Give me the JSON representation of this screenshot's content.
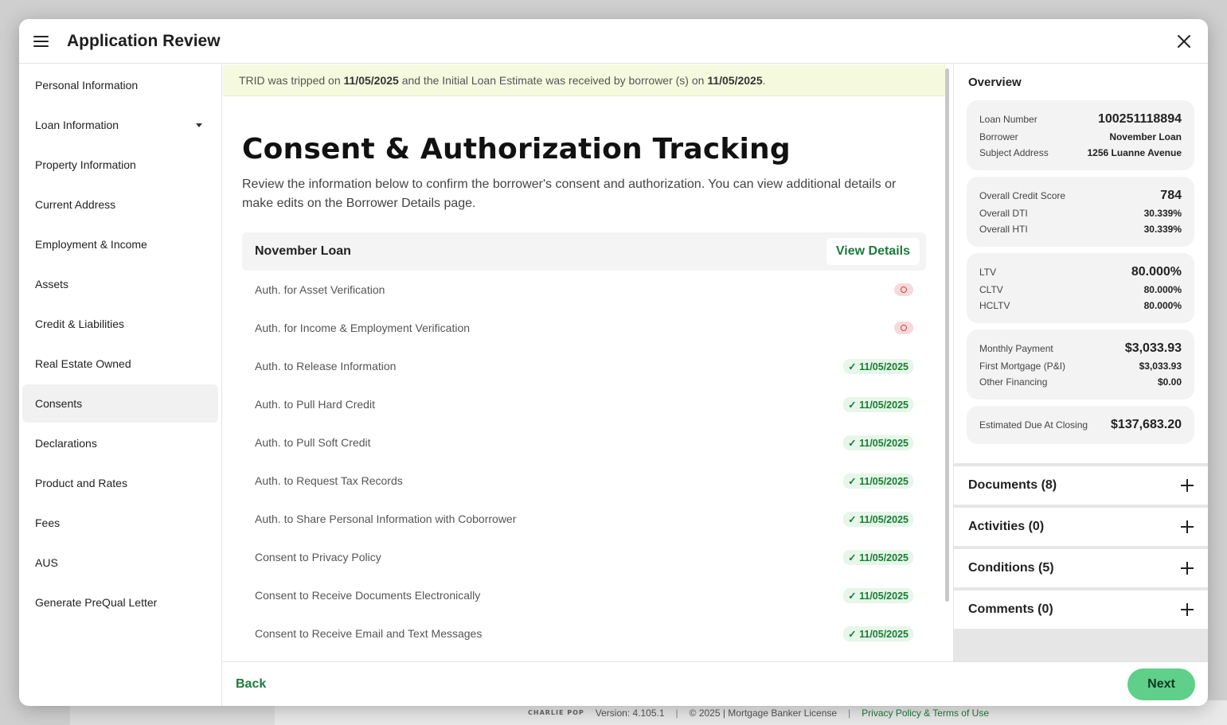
{
  "modal": {
    "title": "Application Review"
  },
  "sidebar": {
    "items": [
      {
        "label": "Personal Information"
      },
      {
        "label": "Loan Information"
      },
      {
        "label": "Property Information"
      },
      {
        "label": "Current Address"
      },
      {
        "label": "Employment & Income"
      },
      {
        "label": "Assets"
      },
      {
        "label": "Credit & Liabilities"
      },
      {
        "label": "Real Estate Owned"
      },
      {
        "label": "Consents"
      },
      {
        "label": "Declarations"
      },
      {
        "label": "Product and Rates"
      },
      {
        "label": "Fees"
      },
      {
        "label": "AUS"
      },
      {
        "label": "Generate PreQual Letter"
      }
    ]
  },
  "banner": {
    "prefix": "TRID was tripped on ",
    "date1": "11/05/2025",
    "middle": " and the Initial Loan Estimate was received by borrower (s) on ",
    "date2": "11/05/2025",
    "suffix": "."
  },
  "main": {
    "title": "Consent & Authorization Tracking",
    "description": "Review the information below to confirm the borrower's consent and authorization. You can view additional details or make edits on the Borrower Details page.",
    "borrower_name": "November Loan",
    "view_details_label": "View Details",
    "rows": [
      {
        "label": "Auth. for Asset Verification",
        "date": ""
      },
      {
        "label": "Auth. for Income & Employment Verification",
        "date": ""
      },
      {
        "label": "Auth. to Release Information",
        "date": "✓ 11/05/2025"
      },
      {
        "label": "Auth. to Pull Hard Credit",
        "date": "✓ 11/05/2025"
      },
      {
        "label": "Auth. to Pull Soft Credit",
        "date": "✓ 11/05/2025"
      },
      {
        "label": "Auth. to Request Tax Records",
        "date": "✓ 11/05/2025"
      },
      {
        "label": "Auth. to Share Personal Information with Coborrower",
        "date": "✓ 11/05/2025"
      },
      {
        "label": "Consent to Privacy Policy",
        "date": "✓ 11/05/2025"
      },
      {
        "label": "Consent to Receive Documents Electronically",
        "date": "✓ 11/05/2025"
      },
      {
        "label": "Consent to Receive Email and Text Messages",
        "date": "✓ 11/05/2025"
      }
    ]
  },
  "footer": {
    "back_label": "Back",
    "next_label": "Next"
  },
  "overview": {
    "title": "Overview",
    "cards": [
      [
        {
          "label": "Loan Number",
          "value": "100251118894",
          "big": true
        },
        {
          "label": "Borrower",
          "value": "November Loan"
        },
        {
          "label": "Subject Address",
          "value": "1256 Luanne Avenue"
        }
      ],
      [
        {
          "label": "Overall Credit Score",
          "value": "784",
          "big": true
        },
        {
          "label": "Overall DTI",
          "value": "30.339%"
        },
        {
          "label": "Overall HTI",
          "value": "30.339%"
        }
      ],
      [
        {
          "label": "LTV",
          "value": "80.000%",
          "big": true
        },
        {
          "label": "CLTV",
          "value": "80.000%"
        },
        {
          "label": "HCLTV",
          "value": "80.000%"
        }
      ],
      [
        {
          "label": "Monthly Payment",
          "value": "$3,033.93",
          "big": true
        },
        {
          "label": "First Mortgage (P&I)",
          "value": "$3,033.93"
        },
        {
          "label": "Other Financing",
          "value": "$0.00"
        }
      ],
      [
        {
          "label": "Estimated Due At Closing",
          "value": "$137,683.20",
          "big": true
        }
      ]
    ]
  },
  "accordions": [
    {
      "label": "Documents (8)"
    },
    {
      "label": "Activities (0)"
    },
    {
      "label": "Conditions (5)"
    },
    {
      "label": "Comments (0)"
    }
  ],
  "bg_footer": {
    "logo": "CHARLIE POP",
    "version": "Version: 4.105.1",
    "copyright": "© 2025 | Mortgage Banker License",
    "link": "Privacy Policy & Terms of Use"
  },
  "colors": {
    "accent_green": "#1c7a3c",
    "next_button": "#5fcf8a",
    "banner_bg": "#f5fadf",
    "success_pill": "#e6f6e9",
    "warn_pill": "#f6d9d9"
  }
}
